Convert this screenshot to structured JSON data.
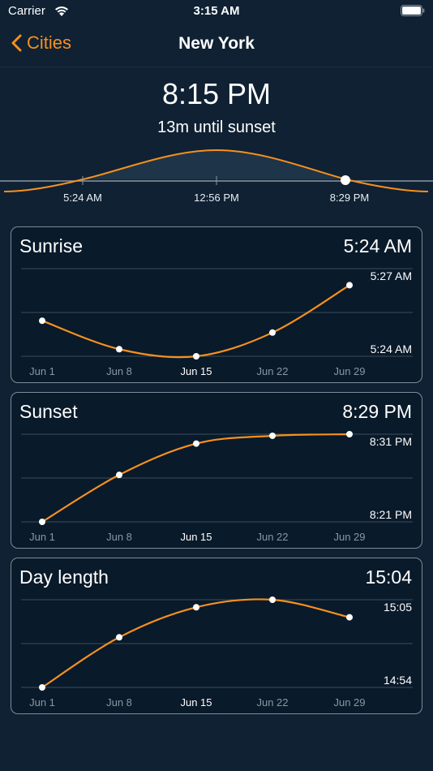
{
  "status": {
    "carrier": "Carrier",
    "time": "3:15 AM"
  },
  "nav": {
    "back_label": "Cities",
    "title": "New York"
  },
  "now": {
    "time": "8:15 PM",
    "countdown": "13m until sunset"
  },
  "sun_path": {
    "labels": [
      "5:24 AM",
      "12:56 PM",
      "8:29 PM"
    ]
  },
  "colors": {
    "accent": "#f7901e",
    "background": "#0f2133",
    "card_bg": "#091a2a"
  },
  "cards": [
    {
      "title": "Sunrise",
      "value": "5:24 AM",
      "top_label": "5:27 AM",
      "bottom_label": "5:24 AM",
      "x_labels": [
        "Jun 1",
        "Jun 8",
        "Jun 15",
        "Jun 22",
        "Jun 29"
      ],
      "highlight_index": 2
    },
    {
      "title": "Sunset",
      "value": "8:29 PM",
      "top_label": "8:31 PM",
      "bottom_label": "8:21 PM",
      "x_labels": [
        "Jun 1",
        "Jun 8",
        "Jun 15",
        "Jun 22",
        "Jun 29"
      ],
      "highlight_index": 2
    },
    {
      "title": "Day length",
      "value": "15:04",
      "top_label": "15:05",
      "bottom_label": "14:54",
      "x_labels": [
        "Jun 1",
        "Jun 8",
        "Jun 15",
        "Jun 22",
        "Jun 29"
      ],
      "highlight_index": 2
    }
  ],
  "chart_data": [
    {
      "type": "line",
      "x": [
        "Jun 1",
        "Jun 8",
        "Jun 15",
        "Jun 22",
        "Jun 29"
      ],
      "values": [
        5.55,
        5.43,
        5.4,
        5.5,
        5.7
      ],
      "ylim": [
        5.4,
        5.77
      ]
    },
    {
      "type": "line",
      "x": [
        "Jun 1",
        "Jun 8",
        "Jun 15",
        "Jun 22",
        "Jun 29"
      ],
      "values": [
        20.35,
        20.45,
        20.5167,
        20.5333,
        20.5367
      ],
      "ylim": [
        20.35,
        20.5367
      ]
    },
    {
      "type": "line",
      "x": [
        "Jun 1",
        "Jun 8",
        "Jun 15",
        "Jun 22",
        "Jun 29"
      ],
      "values": [
        14.9,
        15.0,
        15.06,
        15.075,
        15.04
      ],
      "ylim": [
        14.9,
        15.075
      ]
    }
  ]
}
